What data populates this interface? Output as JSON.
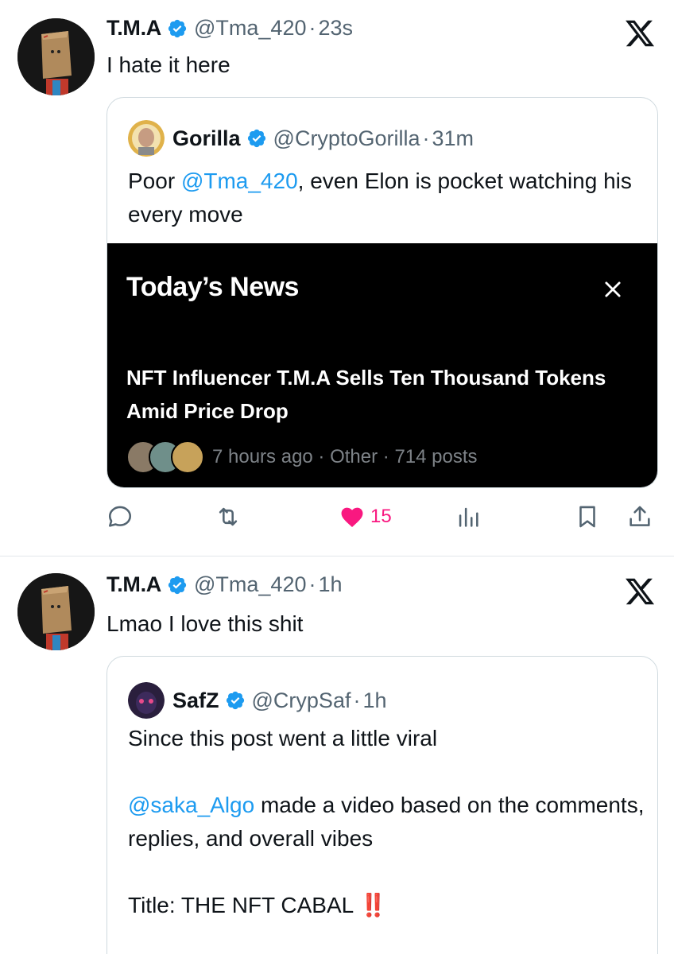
{
  "post1": {
    "author_name": "T.M.A",
    "handle": "@Tma_420",
    "separator": "·",
    "time": "23s",
    "text": "I hate it here",
    "quote": {
      "author_name": "Gorilla",
      "handle": "@CryptoGorilla",
      "separator": "·",
      "time": "31m",
      "text_prefix": "Poor ",
      "mention": "@Tma_420",
      "text_suffix": ", even Elon is pocket watching his every move",
      "news": {
        "title": "Today’s News",
        "headline": "NFT Influencer T.M.A Sells Ten Thousand Tokens Amid Price Drop",
        "meta": "7 hours ago · Other · 714 posts"
      }
    },
    "actions": {
      "like_count": "15"
    }
  },
  "post2": {
    "author_name": "T.M.A",
    "handle": "@Tma_420",
    "separator": "·",
    "time": "1h",
    "text": "Lmao I love this shit",
    "quote": {
      "author_name": "SafZ",
      "handle": "@CrypSaf",
      "separator": "·",
      "time": "1h",
      "line1": "Since this post went a little viral",
      "mention": "@saka_Algo",
      "line2_suffix": " made a video based on the comments, replies, and overall vibes",
      "line3": "Title: THE NFT CABAL ",
      "emoji": "‼️"
    }
  },
  "colors": {
    "accent": "#1d9bf0",
    "like": "#f91880",
    "secondary_text": "#536471",
    "news_background": "#000000"
  },
  "icons": [
    "x-logo-icon",
    "verified-badge-icon",
    "reply-icon",
    "repost-icon",
    "heart-icon",
    "views-icon",
    "bookmark-icon",
    "share-icon",
    "close-icon"
  ]
}
